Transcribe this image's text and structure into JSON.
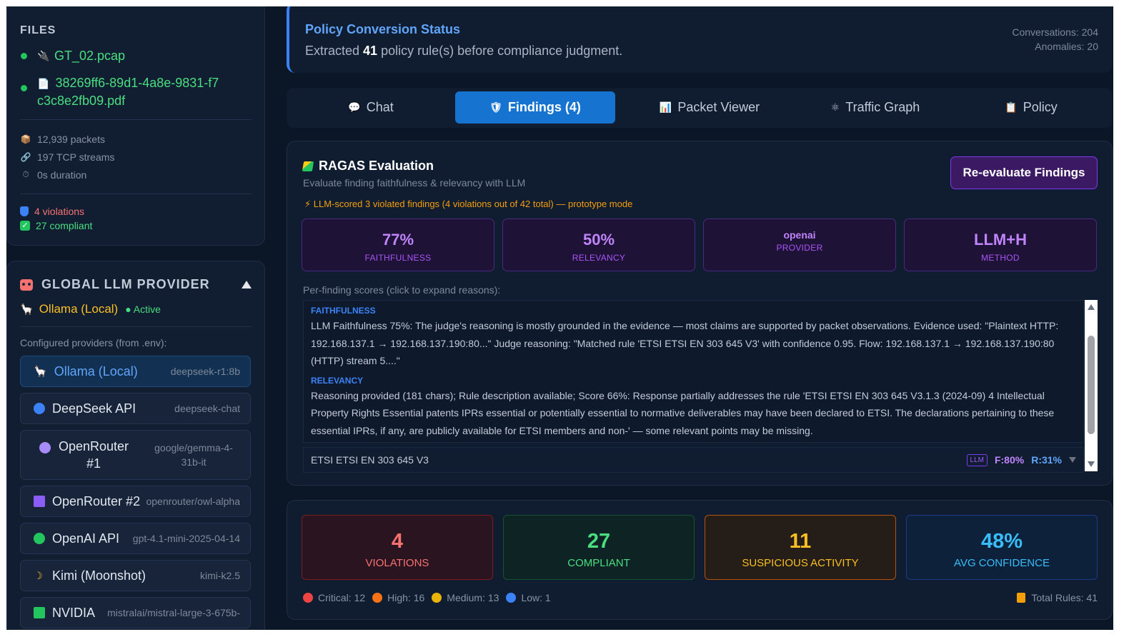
{
  "files": {
    "title": "FILES",
    "items": [
      {
        "icon": "pcap-file-icon",
        "name": "GT_02.pcap"
      },
      {
        "icon": "pdf-file-icon",
        "name": "38269ff6-89d1-4a8e-9831-f7c3c8e2fb09.pdf"
      }
    ],
    "stats": {
      "packets": "12,939 packets",
      "streams": "197 TCP streams",
      "duration": "0s duration"
    },
    "violations": "4 violations",
    "compliant": "27 compliant"
  },
  "llm_provider": {
    "title": "GLOBAL LLM PROVIDER",
    "active_name": "Ollama (Local)",
    "active_badge": "● Active",
    "configured_label": "Configured providers (from .env):",
    "providers": [
      {
        "name": "Ollama (Local)",
        "model": "deepseek-r1:8b",
        "icon": "llama-icon",
        "color": "#e5e7eb",
        "selected": true
      },
      {
        "name": "DeepSeek API",
        "model": "deepseek-chat",
        "icon": "blue-circle-icon",
        "color": "#3b82f6"
      },
      {
        "name": "OpenRouter #1",
        "model": "google/gemma-4-31b-it",
        "icon": "purple-circle-icon",
        "color": "#a78bfa"
      },
      {
        "name": "OpenRouter #2",
        "model": "openrouter/owl-alpha",
        "icon": "purple-square-icon",
        "color": "#8b5cf6"
      },
      {
        "name": "OpenAI API",
        "model": "gpt-4.1-mini-2025-04-14",
        "icon": "green-circle-icon",
        "color": "#22c55e"
      },
      {
        "name": "Kimi (Moonshot)",
        "model": "kimi-k2.5",
        "icon": "moon-icon",
        "color": "#fbbf24"
      },
      {
        "name": "NVIDIA",
        "model": "mistralai/mistral-large-3-675b-",
        "icon": "green-square-icon",
        "color": "#22c55e"
      }
    ]
  },
  "status": {
    "title": "Policy Conversion Status",
    "sub_prefix": "Extracted ",
    "sub_count": "41",
    "sub_suffix": " policy rule(s) before compliance judgment.",
    "conversations": "Conversations: 204",
    "anomalies": "Anomalies: 20"
  },
  "tabs": [
    {
      "label": "Chat",
      "icon": "chat-bubble-icon",
      "glyph": "💬"
    },
    {
      "label": "Findings (4)",
      "icon": "shield-icon",
      "glyph": "🛡",
      "active": true
    },
    {
      "label": "Packet Viewer",
      "icon": "bar-chart-icon",
      "glyph": "📊"
    },
    {
      "label": "Traffic Graph",
      "icon": "network-icon",
      "glyph": "⚛"
    },
    {
      "label": "Policy",
      "icon": "clipboard-icon",
      "glyph": "📋"
    }
  ],
  "ragas": {
    "title": "RAGAS Evaluation",
    "subtitle": "Evaluate finding faithfulness & relevancy with LLM",
    "reevaluate": "Re-evaluate Findings",
    "warning": "⚡ LLM-scored 3 violated findings (4 violations out of 42 total) — prototype mode",
    "metrics": [
      {
        "value": "77%",
        "label": "FAITHFULNESS"
      },
      {
        "value": "50%",
        "label": "RELEVANCY"
      },
      {
        "value": "openai",
        "label": "PROVIDER"
      },
      {
        "value": "LLM+H",
        "label": "METHOD"
      }
    ],
    "per_finding_label": "Per-finding scores (click to expand reasons):",
    "faithfulness_label": "FAITHFULNESS",
    "faithfulness_text": "LLM Faithfulness 75%: The judge's reasoning is mostly grounded in the evidence — most claims are supported by packet observations. Evidence used: \"Plaintext HTTP: 192.168.137.1 → 192.168.137.190:80...\" Judge reasoning: \"Matched rule 'ETSI ETSI EN 303 645 V3' with confidence 0.95. Flow: 192.168.137.1 → 192.168.137.190:80 (HTTP) stream 5....\"",
    "relevancy_label": "RELEVANCY",
    "relevancy_text": "Reasoning provided (181 chars); Rule description available; Score 66%: Response partially addresses the rule 'ETSI ETSI EN 303 645 V3.1.3 (2024-09) 4 Intellectual Property Rights Essential patents IPRs essential or potentially essential to normative deliverables may have been declared to ETSI. The declarations pertaining to these essential IPRs, if any, are publicly available for ETSI members and non-' — some relevant points may be missing.",
    "rule_name": "ETSI ETSI EN 303 645 V3",
    "rule_tag": "LLM",
    "rule_f": "F:80%",
    "rule_r": "R:31%"
  },
  "summary": {
    "boxes": [
      {
        "value": "4",
        "label": "VIOLATIONS"
      },
      {
        "value": "27",
        "label": "COMPLIANT"
      },
      {
        "value": "11",
        "label": "SUSPICIOUS ACTIVITY"
      },
      {
        "value": "48%",
        "label": "AVG CONFIDENCE"
      }
    ],
    "legend": [
      {
        "label": "Critical: 12",
        "color": "#ef4444"
      },
      {
        "label": "High: 16",
        "color": "#f97316"
      },
      {
        "label": "Medium: 13",
        "color": "#eab308"
      },
      {
        "label": "Low: 1",
        "color": "#3b82f6"
      }
    ],
    "total": "Total Rules: 41"
  }
}
